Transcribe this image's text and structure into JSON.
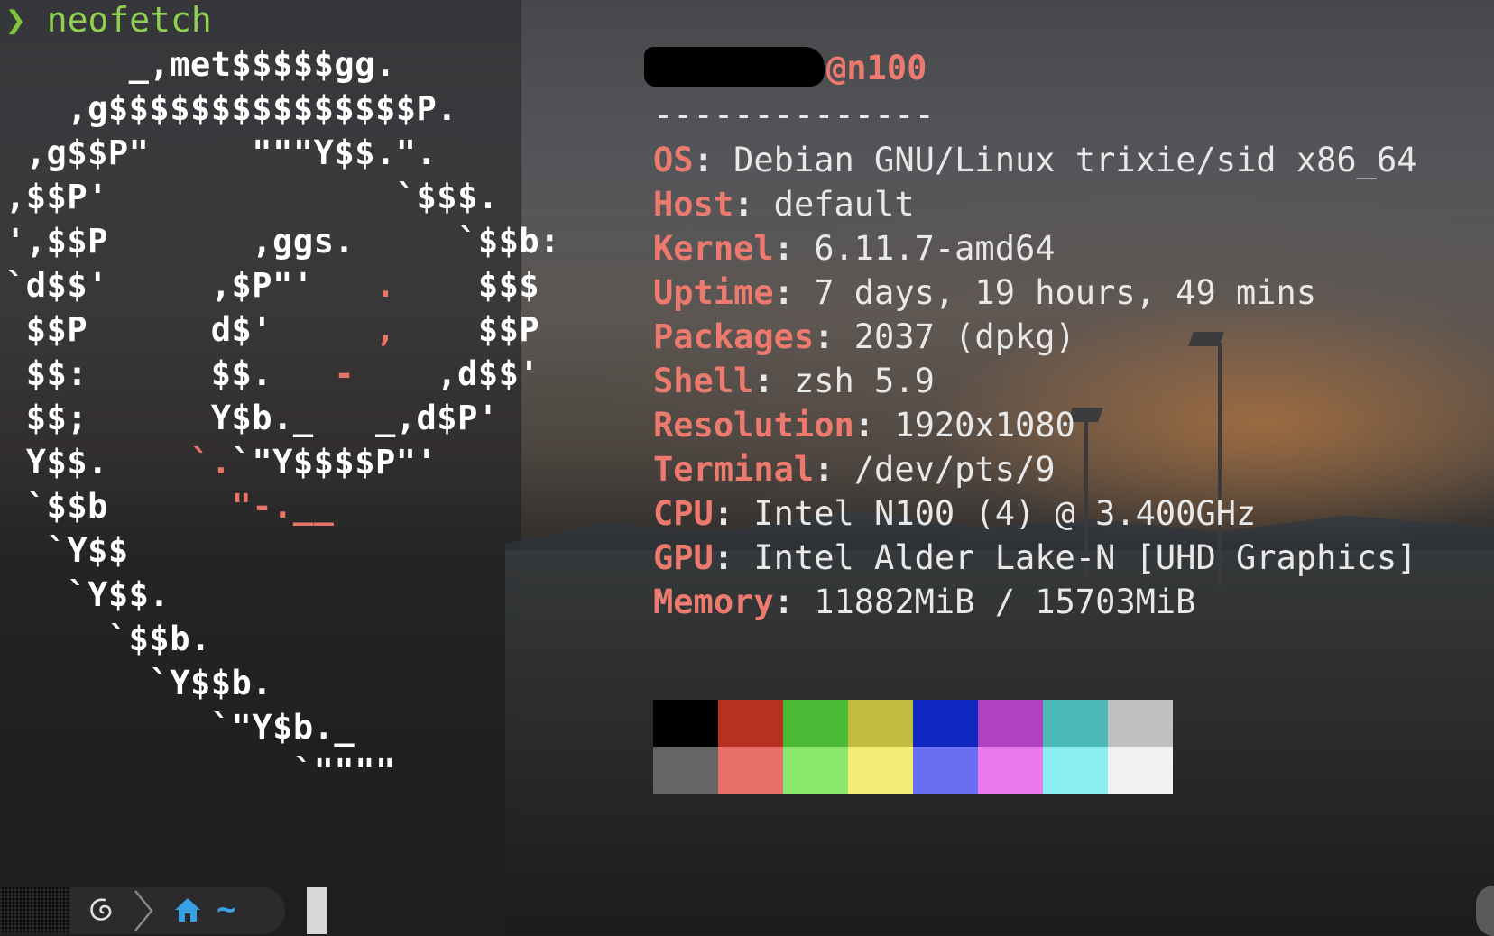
{
  "command": {
    "arrow": "❯",
    "text": "neofetch"
  },
  "logo_lines": [
    {
      "pre": "      _,met$$$$$gg.",
      "red": "",
      "post": ""
    },
    {
      "pre": "   ,g$$$$$$$$$$$$$$$P.",
      "red": "",
      "post": ""
    },
    {
      "pre": " ,g$$P\"     \"\"\"Y$$.\".",
      "red": "",
      "post": ""
    },
    {
      "pre": ",$$P'              `$$$.",
      "red": "",
      "post": ""
    },
    {
      "pre": "',$$P       ,ggs.     `$$b:",
      "red": "",
      "post": ""
    },
    {
      "pre": "`d$$'     ,$P\"'   ",
      "red": ".",
      "post": "    $$$"
    },
    {
      "pre": " $$P      d$'     ",
      "red": ",",
      "post": "    $$P"
    },
    {
      "pre": " $$:      $$.   ",
      "red": "-",
      "post": "    ,d$$'"
    },
    {
      "pre": " $$;      Y$b._   _,d$P'",
      "red": "",
      "post": ""
    },
    {
      "pre": " Y$$.    ",
      "red": "`.",
      "post": "`\"Y$$$$P\"'"
    },
    {
      "pre": " `$$b      ",
      "red": "\"-.__",
      "post": ""
    },
    {
      "pre": "  `Y$$",
      "red": "",
      "post": ""
    },
    {
      "pre": "   `Y$$.",
      "red": "",
      "post": ""
    },
    {
      "pre": "     `$$b.",
      "red": "",
      "post": ""
    },
    {
      "pre": "       `Y$$b.",
      "red": "",
      "post": ""
    },
    {
      "pre": "          `\"Y$b._",
      "red": "",
      "post": ""
    },
    {
      "pre": "              `\"\"\"\"",
      "red": "",
      "post": ""
    }
  ],
  "header": {
    "host": "@n100",
    "separator": "--------------"
  },
  "info": [
    {
      "key": "OS",
      "value": " Debian GNU/Linux trixie/sid x86_64"
    },
    {
      "key": "Host",
      "value": " default"
    },
    {
      "key": "Kernel",
      "value": " 6.11.7-amd64"
    },
    {
      "key": "Uptime",
      "value": " 7 days, 19 hours, 49 mins"
    },
    {
      "key": "Packages",
      "value": " 2037 (dpkg)"
    },
    {
      "key": "Shell",
      "value": " zsh 5.9"
    },
    {
      "key": "Resolution",
      "value": " 1920x1080"
    },
    {
      "key": "Terminal",
      "value": " /dev/pts/9"
    },
    {
      "key": "CPU",
      "value": " Intel N100 (4) @ 3.400GHz"
    },
    {
      "key": "GPU",
      "value": " Intel Alder Lake-N [UHD Graphics]"
    },
    {
      "key": "Memory",
      "value": " 11882MiB / 15703MiB"
    }
  ],
  "palette": {
    "normal": [
      "#000000",
      "#b8311f",
      "#4bbb36",
      "#c2bb40",
      "#1027c2",
      "#b041c0",
      "#4cb8b8",
      "#c0c0c0"
    ],
    "bright": [
      "#656565",
      "#e8706a",
      "#8ce86c",
      "#f2ee76",
      "#6a6ef0",
      "#e87aee",
      "#8ceef0",
      "#f2f2f2"
    ]
  },
  "prompt": {
    "path": "~"
  }
}
